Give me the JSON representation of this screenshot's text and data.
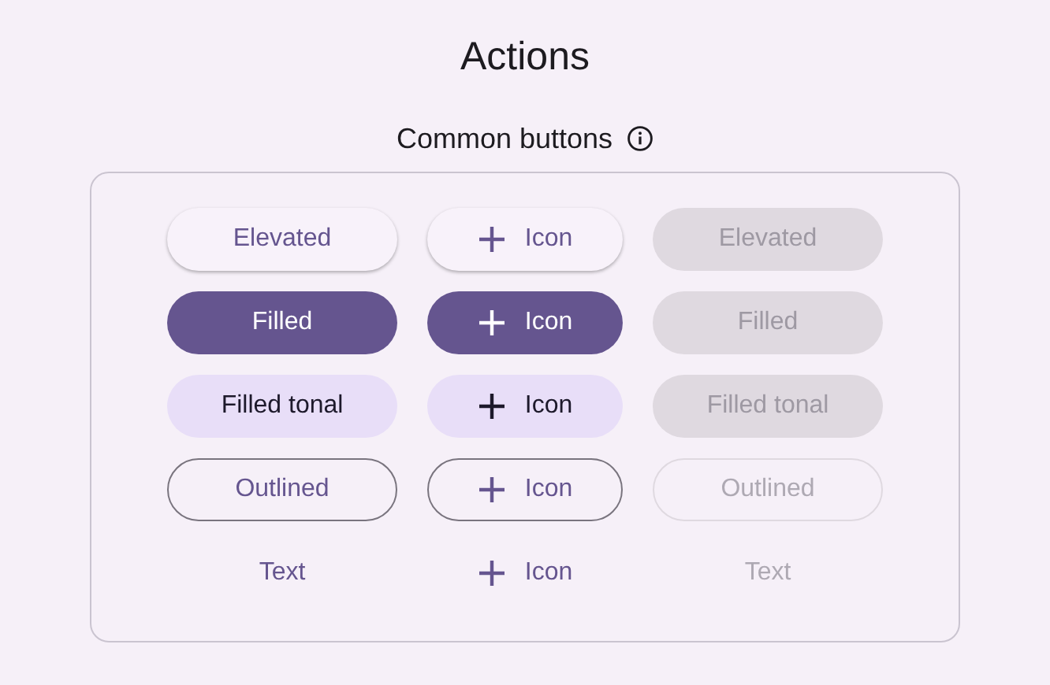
{
  "title": "Actions",
  "section": {
    "title": "Common buttons",
    "info_icon": true
  },
  "rows": [
    {
      "kind": "elevated",
      "buttons": [
        {
          "label": "Elevated",
          "icon": false,
          "disabled": false
        },
        {
          "label": "Icon",
          "icon": true,
          "disabled": false
        },
        {
          "label": "Elevated",
          "icon": false,
          "disabled": true
        }
      ]
    },
    {
      "kind": "filled",
      "buttons": [
        {
          "label": "Filled",
          "icon": false,
          "disabled": false
        },
        {
          "label": "Icon",
          "icon": true,
          "disabled": false
        },
        {
          "label": "Filled",
          "icon": false,
          "disabled": true
        }
      ]
    },
    {
      "kind": "tonal",
      "buttons": [
        {
          "label": "Filled tonal",
          "icon": false,
          "disabled": false
        },
        {
          "label": "Icon",
          "icon": true,
          "disabled": false
        },
        {
          "label": "Filled tonal",
          "icon": false,
          "disabled": true
        }
      ]
    },
    {
      "kind": "outlined",
      "buttons": [
        {
          "label": "Outlined",
          "icon": false,
          "disabled": false
        },
        {
          "label": "Icon",
          "icon": true,
          "disabled": false
        },
        {
          "label": "Outlined",
          "icon": false,
          "disabled": true
        }
      ]
    },
    {
      "kind": "text",
      "buttons": [
        {
          "label": "Text",
          "icon": false,
          "disabled": false
        },
        {
          "label": "Icon",
          "icon": true,
          "disabled": false
        },
        {
          "label": "Text",
          "icon": false,
          "disabled": true
        }
      ]
    }
  ]
}
